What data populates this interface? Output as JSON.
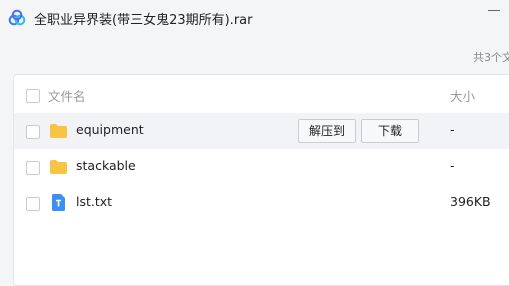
{
  "window": {
    "title": "全职业异界装(带三女鬼23期所有).rar"
  },
  "summary": "共3个文",
  "table": {
    "headers": {
      "name": "文件名",
      "size": "大小"
    },
    "rows": [
      {
        "name": "equipment",
        "type": "folder",
        "size": "-"
      },
      {
        "name": "stackable",
        "type": "folder",
        "size": "-"
      },
      {
        "name": "lst.txt",
        "type": "txt",
        "size": "396KB"
      }
    ]
  },
  "actions": {
    "extract_label": "解压到",
    "download_label": "下载"
  },
  "colors": {
    "folder": "#f7c543",
    "file": "#3e8ef7",
    "logo_blue": "#2f7df6"
  }
}
